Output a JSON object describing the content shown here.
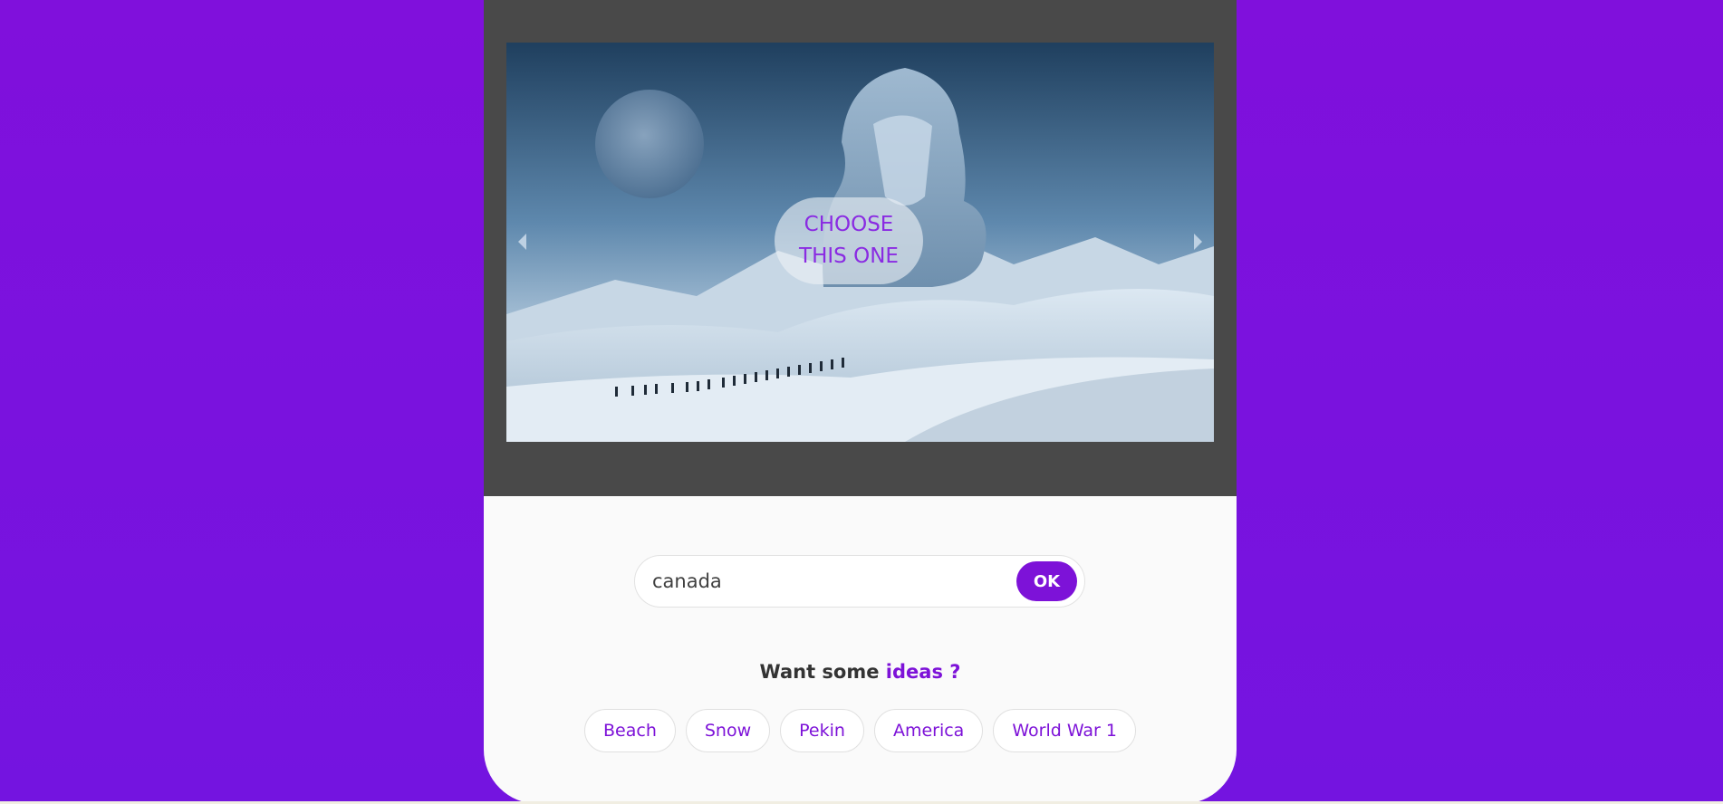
{
  "carousel": {
    "choose_line1": "CHOOSE",
    "choose_line2": "THIS ONE",
    "prev_icon": "caret-left-icon",
    "next_icon": "caret-right-icon",
    "image_subject": "frozen giant statue over snowy landscape with moon and line of hikers"
  },
  "search": {
    "value": "canada",
    "ok_label": "OK"
  },
  "ideas": {
    "prefix": "Want some",
    "accent": "ideas ?",
    "tags": [
      "Beach",
      "Snow",
      "Pekin",
      "America",
      "World War 1"
    ]
  },
  "colors": {
    "accent": "#7d12d8",
    "background_top": "#8010dc",
    "background_bottom": "#7414e0",
    "viewer": "#494949",
    "card": "#fafafa"
  }
}
